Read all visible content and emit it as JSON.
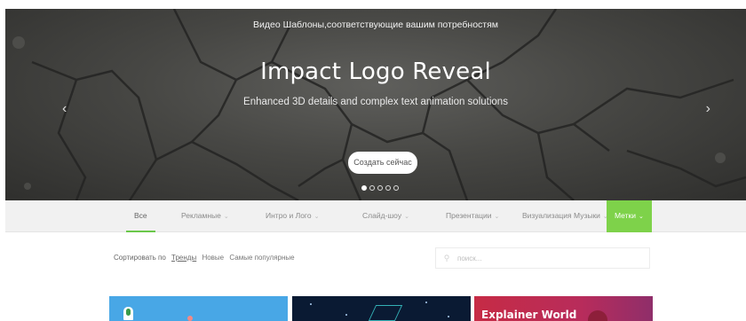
{
  "hero": {
    "top_text": "Видео Шаблоны,соответствующие вашим потребностям",
    "title": "Impact Logo Reveal",
    "description": "Enhanced 3D details and complex text animation solutions",
    "cta_label": "Создать сейчас",
    "prev_icon": "‹",
    "next_icon": "›",
    "slide_count": 5,
    "active_slide": 1
  },
  "categories": [
    {
      "label": "Все",
      "has_dropdown": false
    },
    {
      "label": "Рекламные",
      "has_dropdown": true
    },
    {
      "label": "Интро и Лого",
      "has_dropdown": true
    },
    {
      "label": "Слайд-шоу",
      "has_dropdown": true
    },
    {
      "label": "Презентации",
      "has_dropdown": true
    },
    {
      "label": "Визуализация Музыки",
      "has_dropdown": true
    },
    {
      "label": "Метки",
      "has_dropdown": true
    }
  ],
  "sort": {
    "label": "Сортировать по",
    "options": [
      "Тренды",
      "Новые",
      "Самые популярные"
    ],
    "active": "Тренды"
  },
  "search": {
    "placeholder": "поиск..."
  },
  "cards": [
    {
      "title": ""
    },
    {
      "title": ""
    },
    {
      "title": "Explainer World"
    }
  ],
  "colors": {
    "accent": "#7ed24a",
    "hero_bg": "#474744"
  }
}
